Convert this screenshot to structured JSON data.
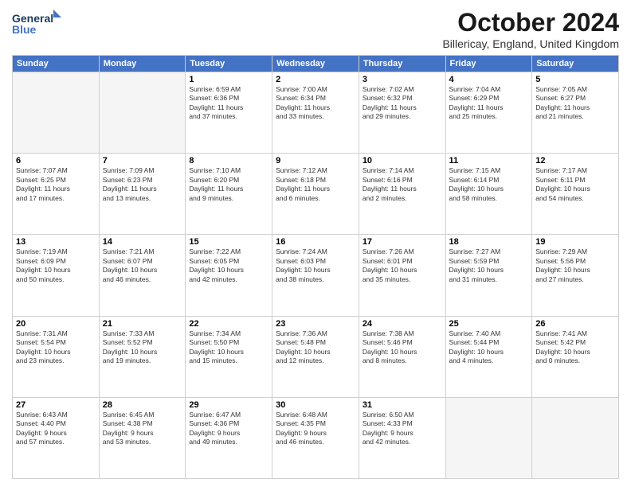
{
  "logo": {
    "line1": "General",
    "line2": "Blue"
  },
  "header": {
    "month": "October 2024",
    "location": "Billericay, England, United Kingdom"
  },
  "days_of_week": [
    "Sunday",
    "Monday",
    "Tuesday",
    "Wednesday",
    "Thursday",
    "Friday",
    "Saturday"
  ],
  "weeks": [
    [
      {
        "day": "",
        "info": ""
      },
      {
        "day": "",
        "info": ""
      },
      {
        "day": "1",
        "info": "Sunrise: 6:59 AM\nSunset: 6:36 PM\nDaylight: 11 hours\nand 37 minutes."
      },
      {
        "day": "2",
        "info": "Sunrise: 7:00 AM\nSunset: 6:34 PM\nDaylight: 11 hours\nand 33 minutes."
      },
      {
        "day": "3",
        "info": "Sunrise: 7:02 AM\nSunset: 6:32 PM\nDaylight: 11 hours\nand 29 minutes."
      },
      {
        "day": "4",
        "info": "Sunrise: 7:04 AM\nSunset: 6:29 PM\nDaylight: 11 hours\nand 25 minutes."
      },
      {
        "day": "5",
        "info": "Sunrise: 7:05 AM\nSunset: 6:27 PM\nDaylight: 11 hours\nand 21 minutes."
      }
    ],
    [
      {
        "day": "6",
        "info": "Sunrise: 7:07 AM\nSunset: 6:25 PM\nDaylight: 11 hours\nand 17 minutes."
      },
      {
        "day": "7",
        "info": "Sunrise: 7:09 AM\nSunset: 6:23 PM\nDaylight: 11 hours\nand 13 minutes."
      },
      {
        "day": "8",
        "info": "Sunrise: 7:10 AM\nSunset: 6:20 PM\nDaylight: 11 hours\nand 9 minutes."
      },
      {
        "day": "9",
        "info": "Sunrise: 7:12 AM\nSunset: 6:18 PM\nDaylight: 11 hours\nand 6 minutes."
      },
      {
        "day": "10",
        "info": "Sunrise: 7:14 AM\nSunset: 6:16 PM\nDaylight: 11 hours\nand 2 minutes."
      },
      {
        "day": "11",
        "info": "Sunrise: 7:15 AM\nSunset: 6:14 PM\nDaylight: 10 hours\nand 58 minutes."
      },
      {
        "day": "12",
        "info": "Sunrise: 7:17 AM\nSunset: 6:11 PM\nDaylight: 10 hours\nand 54 minutes."
      }
    ],
    [
      {
        "day": "13",
        "info": "Sunrise: 7:19 AM\nSunset: 6:09 PM\nDaylight: 10 hours\nand 50 minutes."
      },
      {
        "day": "14",
        "info": "Sunrise: 7:21 AM\nSunset: 6:07 PM\nDaylight: 10 hours\nand 46 minutes."
      },
      {
        "day": "15",
        "info": "Sunrise: 7:22 AM\nSunset: 6:05 PM\nDaylight: 10 hours\nand 42 minutes."
      },
      {
        "day": "16",
        "info": "Sunrise: 7:24 AM\nSunset: 6:03 PM\nDaylight: 10 hours\nand 38 minutes."
      },
      {
        "day": "17",
        "info": "Sunrise: 7:26 AM\nSunset: 6:01 PM\nDaylight: 10 hours\nand 35 minutes."
      },
      {
        "day": "18",
        "info": "Sunrise: 7:27 AM\nSunset: 5:59 PM\nDaylight: 10 hours\nand 31 minutes."
      },
      {
        "day": "19",
        "info": "Sunrise: 7:29 AM\nSunset: 5:56 PM\nDaylight: 10 hours\nand 27 minutes."
      }
    ],
    [
      {
        "day": "20",
        "info": "Sunrise: 7:31 AM\nSunset: 5:54 PM\nDaylight: 10 hours\nand 23 minutes."
      },
      {
        "day": "21",
        "info": "Sunrise: 7:33 AM\nSunset: 5:52 PM\nDaylight: 10 hours\nand 19 minutes."
      },
      {
        "day": "22",
        "info": "Sunrise: 7:34 AM\nSunset: 5:50 PM\nDaylight: 10 hours\nand 15 minutes."
      },
      {
        "day": "23",
        "info": "Sunrise: 7:36 AM\nSunset: 5:48 PM\nDaylight: 10 hours\nand 12 minutes."
      },
      {
        "day": "24",
        "info": "Sunrise: 7:38 AM\nSunset: 5:46 PM\nDaylight: 10 hours\nand 8 minutes."
      },
      {
        "day": "25",
        "info": "Sunrise: 7:40 AM\nSunset: 5:44 PM\nDaylight: 10 hours\nand 4 minutes."
      },
      {
        "day": "26",
        "info": "Sunrise: 7:41 AM\nSunset: 5:42 PM\nDaylight: 10 hours\nand 0 minutes."
      }
    ],
    [
      {
        "day": "27",
        "info": "Sunrise: 6:43 AM\nSunset: 4:40 PM\nDaylight: 9 hours\nand 57 minutes."
      },
      {
        "day": "28",
        "info": "Sunrise: 6:45 AM\nSunset: 4:38 PM\nDaylight: 9 hours\nand 53 minutes."
      },
      {
        "day": "29",
        "info": "Sunrise: 6:47 AM\nSunset: 4:36 PM\nDaylight: 9 hours\nand 49 minutes."
      },
      {
        "day": "30",
        "info": "Sunrise: 6:48 AM\nSunset: 4:35 PM\nDaylight: 9 hours\nand 46 minutes."
      },
      {
        "day": "31",
        "info": "Sunrise: 6:50 AM\nSunset: 4:33 PM\nDaylight: 9 hours\nand 42 minutes."
      },
      {
        "day": "",
        "info": ""
      },
      {
        "day": "",
        "info": ""
      }
    ]
  ]
}
